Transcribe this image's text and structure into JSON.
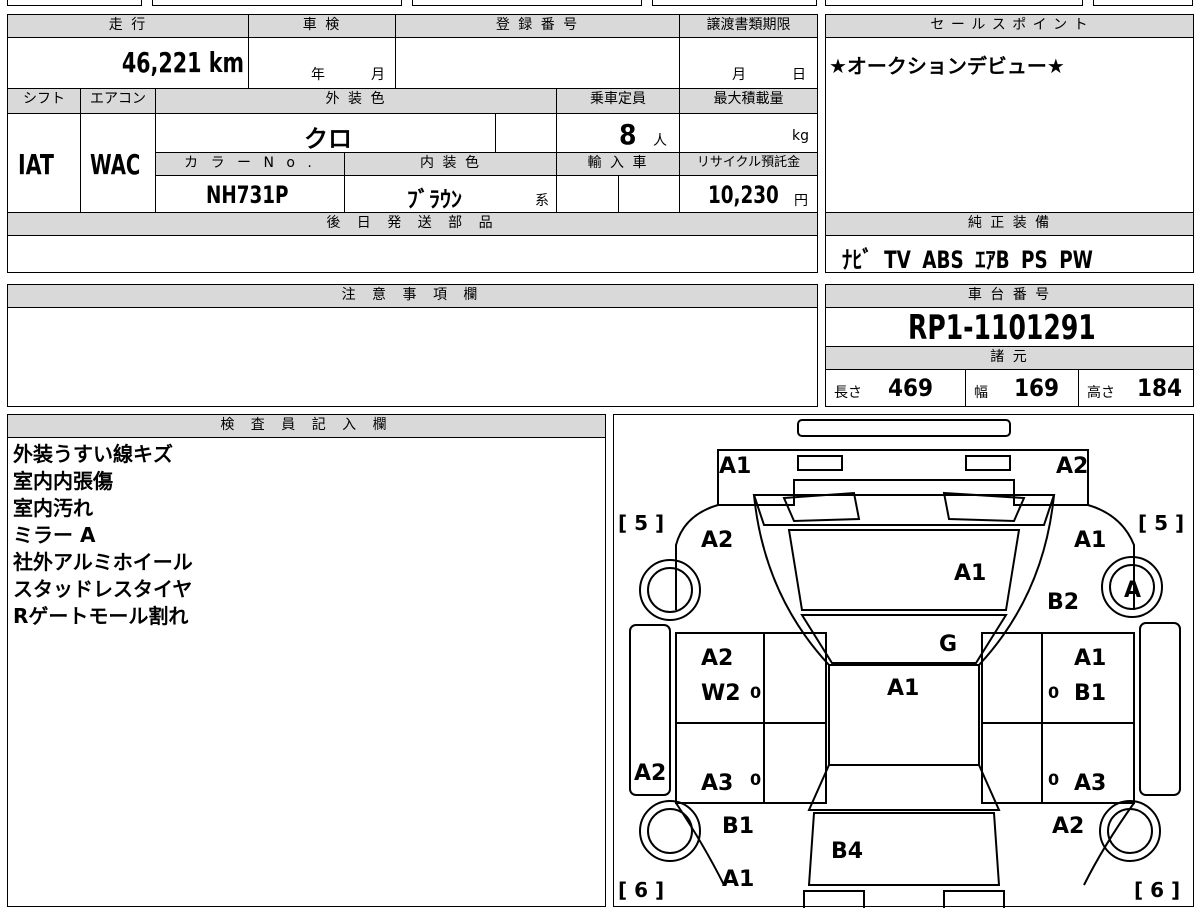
{
  "labels": {
    "mileage": "走 行",
    "inspection": "車 検",
    "registration_no": "登 録 番 号",
    "transfer_deadline": "譲渡書類期限",
    "sales_point": "セ ー ル ス ポ イ ン ト",
    "shift": "シフト",
    "aircon": "エアコン",
    "exterior_color": "外 装 色",
    "capacity": "乗車定員",
    "max_load": "最大積載量",
    "color_no": "カ ラ ー N o .",
    "interior_color": "内 装 色",
    "import": "輸 入 車",
    "recycle_fee": "リサイクル預託金",
    "later_parts": "後 日 発 送 部 品",
    "genuine_equipment": "純 正 装 備",
    "notes": "注 意 事 項 欄",
    "chassis_no": "車 台 番 号",
    "specs": "諸 元",
    "inspector": "検 査 員 記 入 欄"
  },
  "units": {
    "year": "年",
    "month": "月",
    "day": "日",
    "person": "人",
    "kg": "kg",
    "yen": "円",
    "kei": "系"
  },
  "values": {
    "mileage": "46,221 km",
    "shift": "IAT",
    "aircon": "WAC",
    "exterior_color": "クロ",
    "capacity": "8",
    "color_no": "NH731P",
    "interior_color": "ﾌﾞﾗｳﾝ",
    "recycle_fee": "10,230",
    "sales_point": "★オークションデビュー★",
    "genuine_equipment": "ﾅﾋﾞ TV ABS ｴｱB PS PW",
    "chassis_no": "RP1-1101291",
    "length_label": "長さ",
    "length": "469",
    "width_label": "幅",
    "width": "169",
    "height_label": "高さ",
    "height": "184"
  },
  "inspector_notes": [
    "外装うすい線キズ",
    "室内内張傷",
    "室内汚れ",
    "ミラー A",
    "社外アルミホイール",
    "スタッドレスタイヤ",
    "Rゲートモール割れ"
  ],
  "diagram_marks": {
    "front_left": "A1",
    "front_right": "A2",
    "fender_left": "A2",
    "fender_right": "A1",
    "hood": "A1",
    "right_front_extra": "B2",
    "mirror_right": "A",
    "windshield": "G",
    "roof": "A1",
    "front_door_left_1": "A2",
    "front_door_left_2": "W2",
    "front_door_right_1": "A1",
    "front_door_right_2": "B1",
    "side_left": "A2",
    "rear_door_left": "A3",
    "rear_door_right": "A3",
    "rear_fender_left": "B1",
    "rear_fender_right": "A2",
    "tailgate": "B4",
    "rear_left": "A1",
    "tire_tread_front_left": "[ 5 ]",
    "tire_tread_front_right": "[ 5 ]",
    "tire_tread_rear_left": "[ 6 ]",
    "tire_tread_rear_right": "[ 6 ]",
    "door_zero_1": "0",
    "door_zero_2": "0",
    "door_zero_3": "0",
    "door_zero_4": "0"
  }
}
